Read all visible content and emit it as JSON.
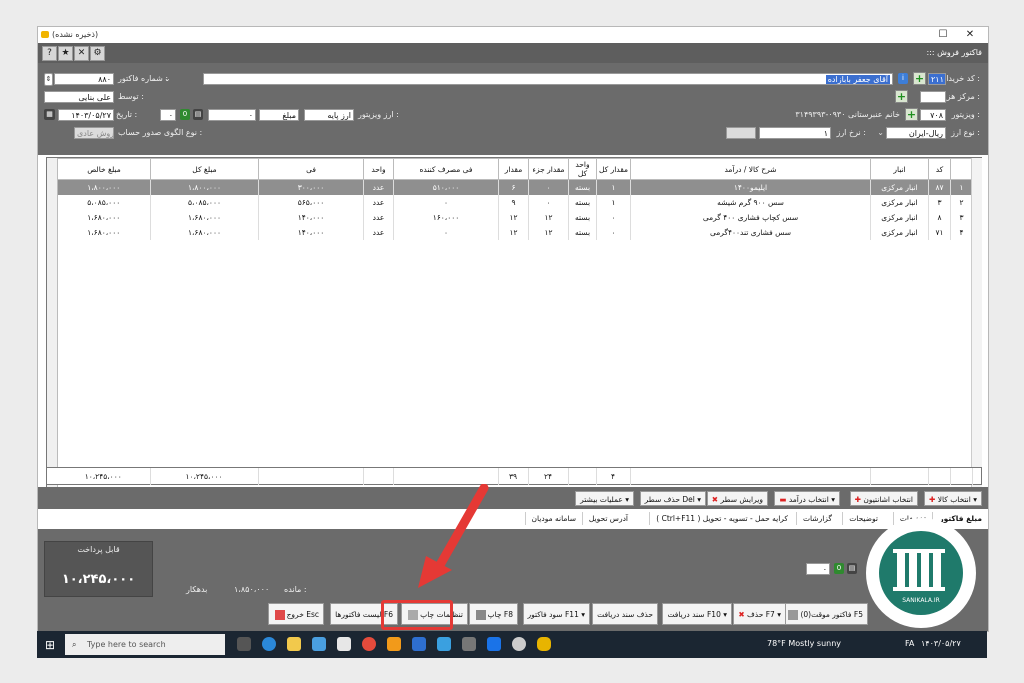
{
  "window": {
    "title": "(ذخیره نشده)",
    "form_title": "::: فاکتور فروش",
    "buttons": [
      "─",
      "☐",
      "✕"
    ]
  },
  "header": {
    "buyer_code_label": "کد خریدار :",
    "buyer_code": "۲۱۱",
    "buyer_name": "آقای جعفر بابازاده",
    "cost_center_label": "مرکز هزینه :",
    "visitor_label": "ویزیتور :",
    "visitor_code": "۷۰۸",
    "visitor_name": "خانم عنبرستانی ۰۹۳۰-۳۱۴۹۳۹۳",
    "currency_type_label": "نوع ارز :",
    "currency_type": "ریال-ایران",
    "rate_label": "نرخ ارز :",
    "rate_value": "۱",
    "invoice_no_label": "شماره فاکتور :",
    "invoice_no": "۸۸۰",
    "by_label": "توسط :",
    "by_value": "علی بنایی",
    "date_label": "تاریخ :",
    "date": "۱۴۰۳/۰۵/۲۷",
    "time_value": "۰",
    "visitor_currency_label": "ارز ویزیتور :",
    "base_currency": "ارز پایه",
    "amount_label": "مبلغ",
    "pattern_label": "نوع الگوی صدور حساب :",
    "pattern_value": "فروش عادی"
  },
  "grid": {
    "columns": [
      "",
      "کد",
      "انبار",
      "شرح کالا / درآمد",
      "مقدار کل",
      "واحد کل",
      "مقدار جزء",
      "مقدار",
      "فی مصرف کننده",
      "واحد",
      "فی",
      "مبلغ کل",
      "مبلغ خالص"
    ],
    "rows": [
      [
        "۱",
        "۸۷",
        "انبار مرکزی",
        "ایلیمو۱۴۰۰",
        "۱",
        "بسته",
        "۰",
        "۶",
        "۵۱۰،۰۰۰",
        "عدد",
        "۳۰۰،۰۰۰",
        "۱،۸۰۰،۰۰۰",
        "۱،۸۰۰،۰۰۰"
      ],
      [
        "۲",
        "۳",
        "انبار مرکزی",
        "سس ۹۰۰ گرم شیشه",
        "۱",
        "بسته",
        "۰",
        "۹",
        "۰",
        "عدد",
        "۵۶۵،۰۰۰",
        "۵،۰۸۵،۰۰۰",
        "۵،۰۸۵،۰۰۰"
      ],
      [
        "۳",
        "۸",
        "انبار مرکزی",
        "سس کچاپ فشاری ۴۰۰ گرمی",
        "۰",
        "بسته",
        "۱۲",
        "۱۲",
        "۱۶۰،۰۰۰",
        "عدد",
        "۱۴۰،۰۰۰",
        "۱،۶۸۰،۰۰۰",
        "۱،۶۸۰،۰۰۰"
      ],
      [
        "۴",
        "۷۱",
        "انبار مرکزی",
        "سس فشاری تند۴۰۰گرمی",
        "۰",
        "بسته",
        "۱۲",
        "۱۲",
        "۰",
        "عدد",
        "۱۴۰،۰۰۰",
        "۱،۶۸۰،۰۰۰",
        "۱،۶۸۰،۰۰۰"
      ]
    ],
    "totals": {
      "count": "۴",
      "partial": "۲۴",
      "qty": "۳۹",
      "total": "۱۰،۲۴۵،۰۰۰",
      "net": "۱۰،۲۴۵،۰۰۰"
    }
  },
  "row_actions": [
    "انتخاب کالا",
    "انتخاب اشانتیون",
    "انتخاب درآمد",
    "ویرایش سطر",
    "حذف سطر Del",
    "عملیات بیشتر"
  ],
  "tabs": [
    "مبلغ فاکتور",
    "تخفیفات",
    "توضیحات",
    "گزارشات",
    "( Ctrl+F11 ) کرایه حمل - تسویه - تحویل",
    "آدرس تحویل",
    "سامانه مودیان"
  ],
  "footer": {
    "payable_label": "قابل پرداخت",
    "payable_value": "۱۰،۲۴۵،۰۰۰",
    "balance_label": "مانده :",
    "balance_value": "۱،۸۵۰،۰۰۰",
    "debtor_label": "بدهکار",
    "zero": "۰"
  },
  "actions": [
    "فاکتور موقت(0) F5",
    "حذف F7",
    "سند دریافت F10",
    "حذف سند دریافت",
    "سود فاکتور F11",
    "چاپ F8",
    "تنظیمات چاپ",
    "لیست فاکتورها F6",
    "خروج Esc"
  ],
  "taskbar": {
    "search_placeholder": "Type here to search",
    "weather": "78°F  Mostly sunny",
    "lang": "FA",
    "date": "۱۴۰۳/۰۵/۲۷"
  },
  "watermark": {
    "text": "SANIKALA.IR"
  }
}
